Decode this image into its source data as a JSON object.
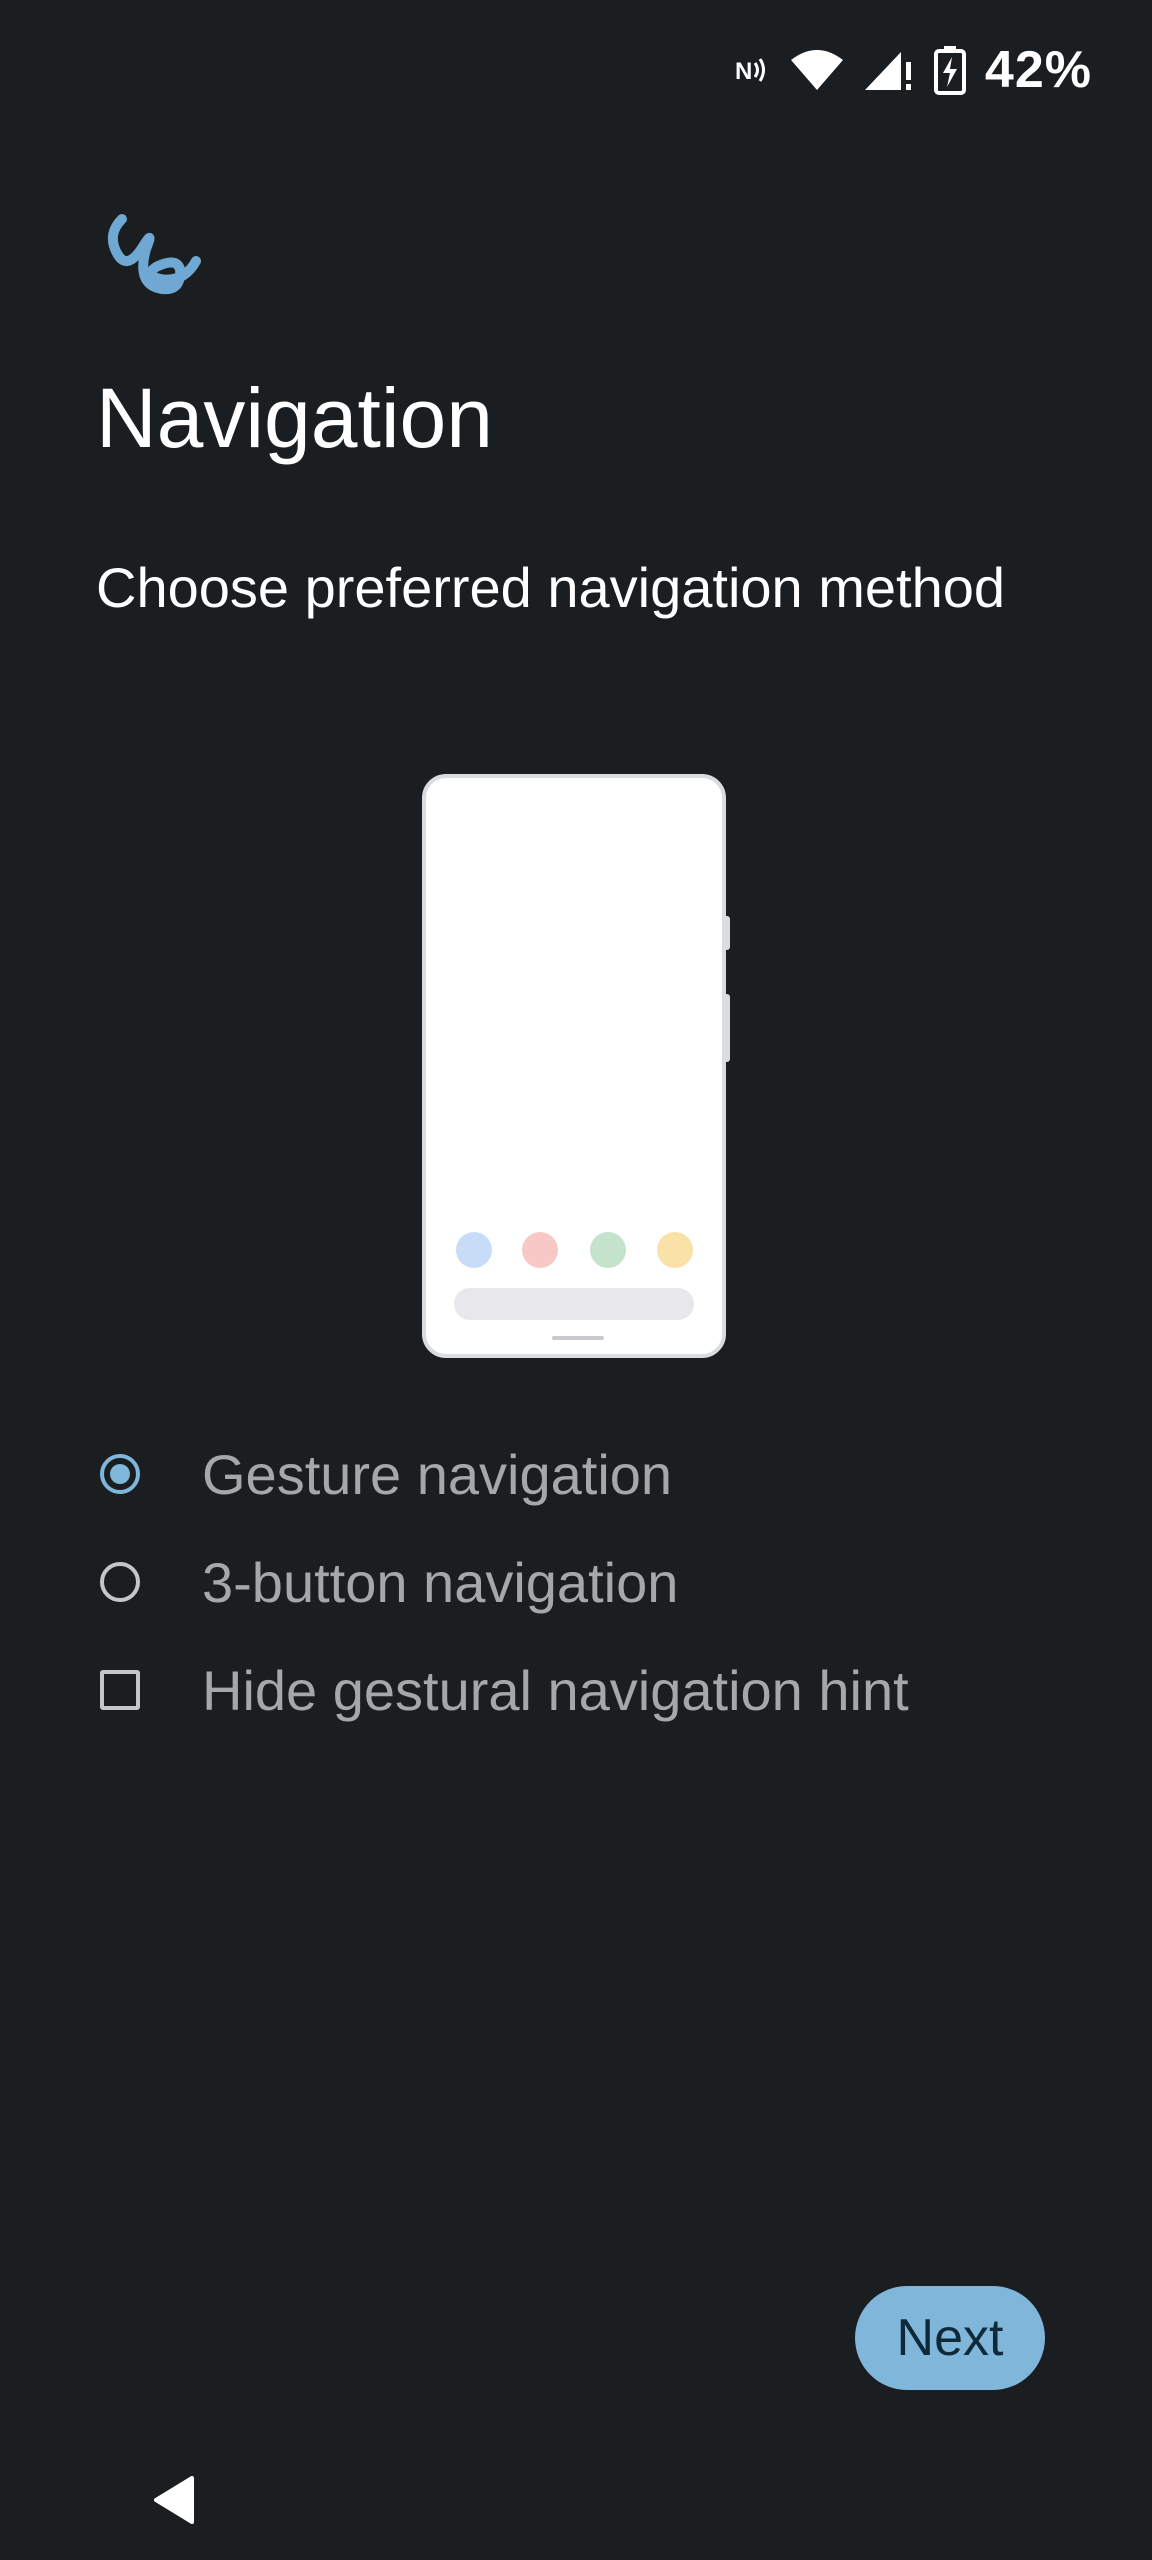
{
  "status_bar": {
    "nfc_icon": "nfc-icon",
    "wifi_icon": "wifi-icon",
    "signal_icon": "signal-icon",
    "battery_icon": "battery-charging-icon",
    "battery_percent": "42%"
  },
  "header": {
    "logo_icon": "setup-squiggle-icon",
    "title": "Navigation",
    "subtitle": "Choose preferred navigation method"
  },
  "illustration": {
    "dot_colors": [
      "#c9dcf7",
      "#f8c8c6",
      "#c3e3cc",
      "#f8e2a8"
    ]
  },
  "options": [
    {
      "label": "Gesture navigation",
      "type": "radio",
      "selected": true
    },
    {
      "label": "3-button navigation",
      "type": "radio",
      "selected": false
    },
    {
      "label": "Hide gestural navigation hint",
      "type": "checkbox",
      "checked": false
    }
  ],
  "footer": {
    "next_label": "Next",
    "back_icon": "back-triangle-icon"
  },
  "colors": {
    "background": "#1b1e20",
    "accent": "#7fb6da",
    "option_text": "#a5a8ab"
  }
}
